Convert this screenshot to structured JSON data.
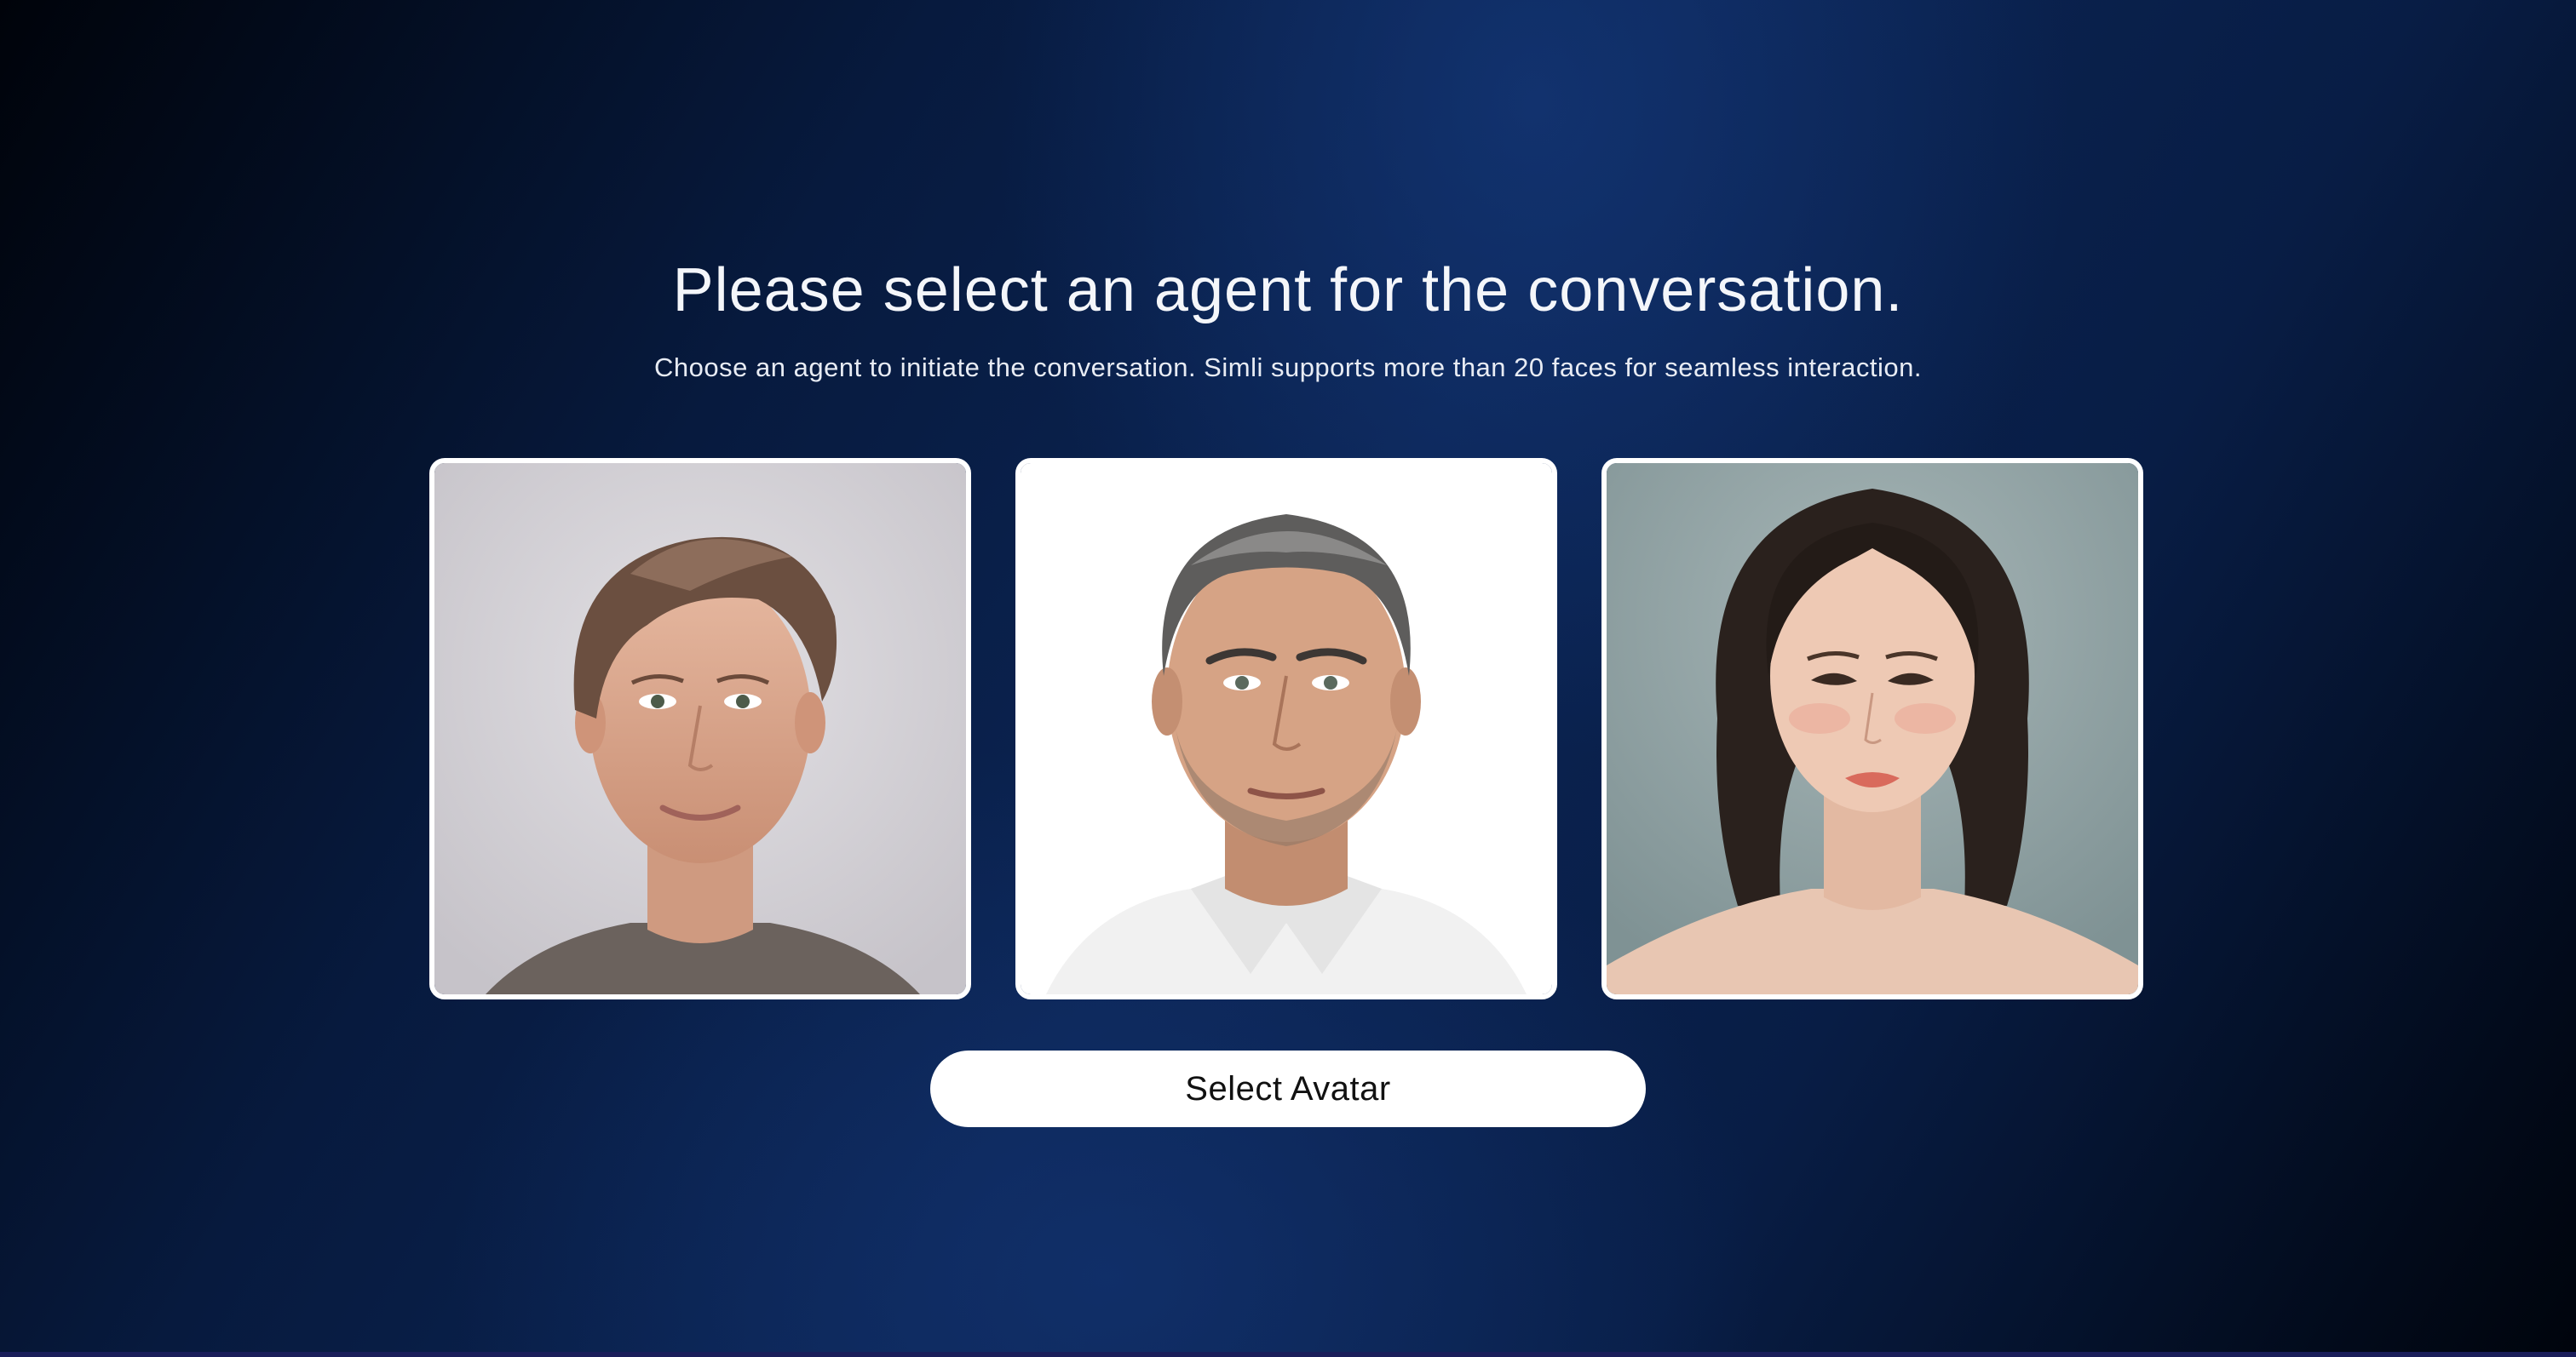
{
  "header": {
    "title": "Please select an agent for the conversation.",
    "subtitle": "Choose an agent to initiate the conversation. Simli supports more than 20 faces for seamless interaction."
  },
  "avatars": [
    {
      "description": "woman-short-hair-portrait",
      "background": "#d4d2d6"
    },
    {
      "description": "man-grey-hair-white-shirt-portrait",
      "background": "#ffffff"
    },
    {
      "description": "young-woman-dark-hair-portrait",
      "background": "#8fa0a2"
    }
  ],
  "actions": {
    "select_label": "Select Avatar"
  }
}
